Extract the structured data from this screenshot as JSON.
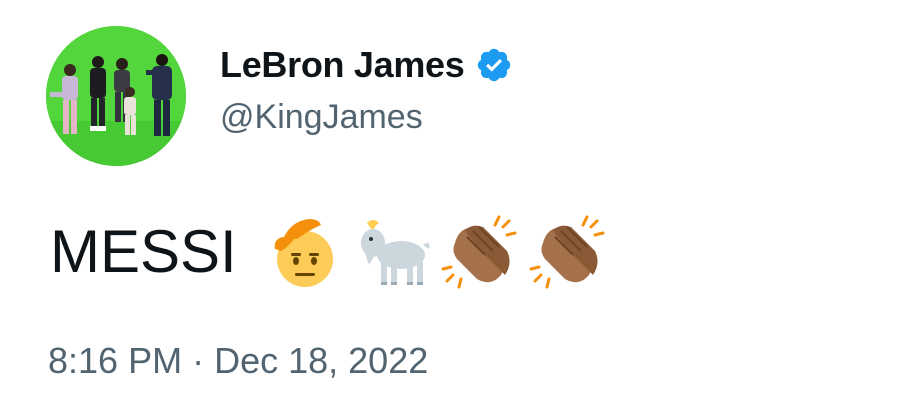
{
  "tweet": {
    "author": {
      "display_name": "LeBron James",
      "handle": "@KingJames",
      "verified": true
    },
    "text": "MESSI",
    "emojis": [
      "saluting-face",
      "goat",
      "clapping-hands-medium-dark",
      "clapping-hands-medium-dark"
    ],
    "timestamp": {
      "time": "8:16 PM",
      "separator": "·",
      "date": "Dec 18, 2022"
    }
  },
  "colors": {
    "verified_blue": "#1d9bf0",
    "secondary_text": "#536471",
    "primary_text": "#0f1419",
    "avatar_bg": "#4fd23a"
  }
}
